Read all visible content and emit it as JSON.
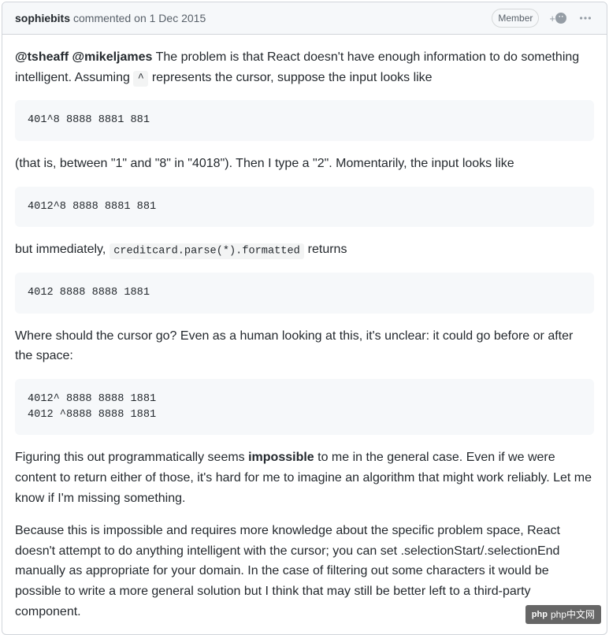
{
  "header": {
    "author": "sophiebits",
    "action": "commented",
    "date": "on 1 Dec 2015",
    "badge": "Member",
    "plus": "+"
  },
  "body": {
    "mention1": "@tsheaff",
    "mention2": "@mikeljames",
    "para1_text": " The problem is that React doesn't have enough information to do something intelligent. Assuming ",
    "caret_code": "^",
    "para1_tail": " represents the cursor, suppose the input looks like",
    "code1": "401^8 8888 8881 881",
    "para2": "(that is, between \"1\" and \"8\" in \"4018\"). Then I type a \"2\". Momentarily, the input looks like",
    "code2": "4012^8 8888 8881 881",
    "para3_head": "but immediately, ",
    "para3_code": "creditcard.parse(*).formatted",
    "para3_tail": " returns",
    "code3": "4012 8888 8888 1881",
    "para4": "Where should the cursor go? Even as a human looking at this, it's unclear: it could go before or after the space:",
    "code4": "4012^ 8888 8888 1881\n4012 ^8888 8888 1881",
    "para5_head": "Figuring this out programmatically seems ",
    "para5_bold": "impossible",
    "para5_tail": " to me in the general case. Even if we were content to return either of those, it's hard for me to imagine an algorithm that might work reliably. Let me know if I'm missing something.",
    "para6": "Because this is impossible and requires more knowledge about the specific problem space, React doesn't attempt to do anything intelligent with the cursor; you can set .selectionStart/.selectionEnd manually as appropriate for your domain. In the case of filtering out some characters it would be possible to write a more general solution but I think that may still be better left to a third-party component."
  },
  "watermark": {
    "text": "php中文网"
  }
}
